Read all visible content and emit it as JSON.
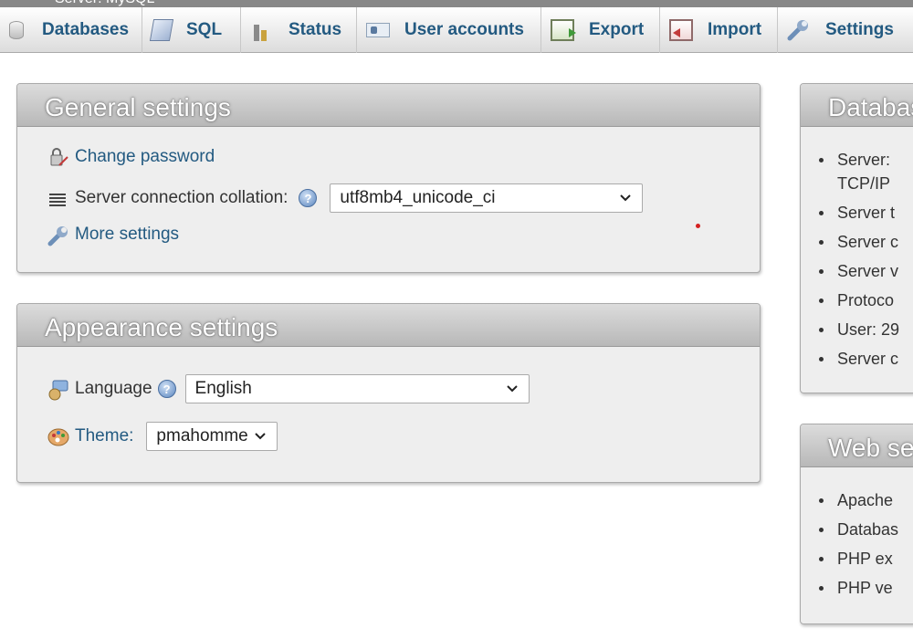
{
  "breadcrumb": "Server: MySQL",
  "tabs": [
    {
      "label": "Databases",
      "icon": "database-icon"
    },
    {
      "label": "SQL",
      "icon": "sql-icon"
    },
    {
      "label": "Status",
      "icon": "status-icon"
    },
    {
      "label": "User accounts",
      "icon": "user-accounts-icon"
    },
    {
      "label": "Export",
      "icon": "export-icon"
    },
    {
      "label": "Import",
      "icon": "import-icon"
    },
    {
      "label": "Settings",
      "icon": "wrench-icon"
    }
  ],
  "general": {
    "title": "General settings",
    "change_password": "Change password",
    "collation_label": "Server connection collation:",
    "collation_value": "utf8mb4_unicode_ci",
    "more_settings": "More settings"
  },
  "appearance": {
    "title": "Appearance settings",
    "language_label": "Language",
    "language_value": "English",
    "theme_label": "Theme:",
    "theme_value": "pmahomme"
  },
  "database_server": {
    "title": "Database server",
    "items": [
      "Server:",
      "TCP/IP",
      "Server t",
      "Server c",
      "Server v",
      "Protoco",
      "User: 29",
      "Server c"
    ]
  },
  "web_server": {
    "title": "Web server",
    "items": [
      "Apache",
      "Databas",
      "PHP ex",
      "PHP ve"
    ]
  },
  "colors": {
    "link": "#235a81",
    "panel_bg": "#eeeeee",
    "header_gradient_top": "#dcdcdc",
    "header_gradient_bottom": "#b8b8b8"
  }
}
